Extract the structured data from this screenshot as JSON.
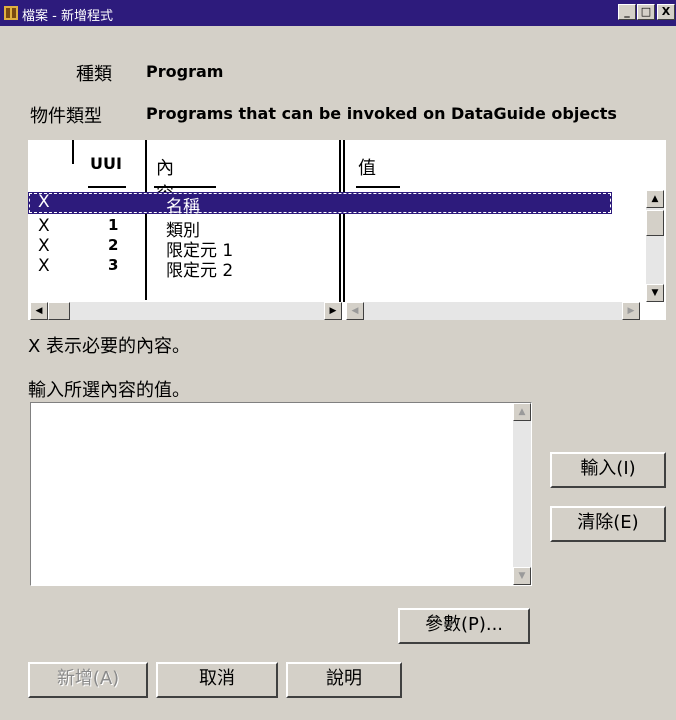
{
  "window": {
    "title": "檔案 - 新增程式",
    "controls": {
      "minimize": "_",
      "maximize": "□",
      "close": "X"
    }
  },
  "info": {
    "kind_label": "種類",
    "kind_value": "Program",
    "objtype_label": "物件類型",
    "objtype_value": "Programs that can be invoked on DataGuide objects"
  },
  "grid": {
    "headers": {
      "uui": "UUI",
      "content": "內容",
      "value": "值"
    },
    "rows": [
      {
        "req": "X",
        "uui": "",
        "content": "名稱",
        "value": ""
      },
      {
        "req": "X",
        "uui": "1",
        "content": "類別",
        "value": ""
      },
      {
        "req": "X",
        "uui": "2",
        "content": "限定元 1",
        "value": ""
      },
      {
        "req": "X",
        "uui": "3",
        "content": "限定元 2",
        "value": ""
      }
    ],
    "selected_row": 0
  },
  "note": "X 表示必要的內容。",
  "input_label": "輸入所選內容的值。",
  "input_value": "",
  "buttons": {
    "enter": "輸入(I)",
    "clear": "清除(E)",
    "params": "參數(P)...",
    "add": "新增(A)",
    "cancel": "取消",
    "help": "說明"
  },
  "icons": {
    "window_icon": "archive-icon"
  }
}
